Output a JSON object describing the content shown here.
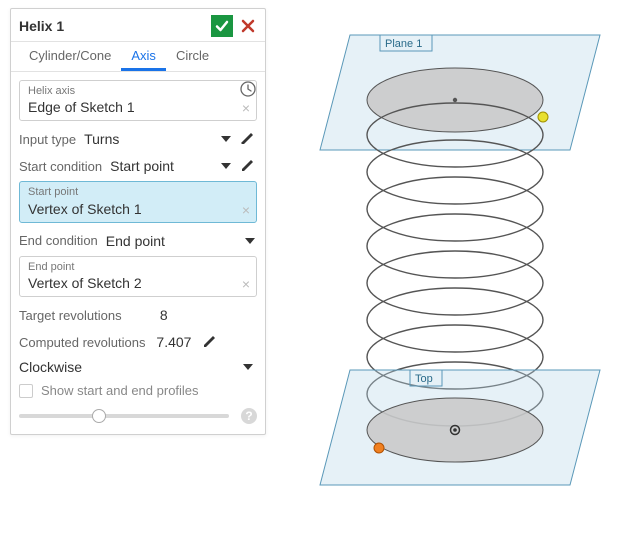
{
  "panel": {
    "title": "Helix 1",
    "tabs": [
      "Cylinder/Cone",
      "Axis",
      "Circle"
    ],
    "active_tab_index": 1,
    "helix_axis": {
      "label": "Helix axis",
      "value": "Edge of Sketch 1"
    },
    "input_type": {
      "label": "Input type",
      "value": "Turns"
    },
    "start_condition": {
      "label": "Start condition",
      "value": "Start point"
    },
    "start_point": {
      "label": "Start point",
      "value": "Vertex of Sketch 1",
      "active": true
    },
    "end_condition": {
      "label": "End condition",
      "value": "End point"
    },
    "end_point": {
      "label": "End point",
      "value": "Vertex of Sketch 2"
    },
    "target_revs": {
      "label": "Target revolutions",
      "value": "8"
    },
    "computed_revs": {
      "label": "Computed revolutions",
      "value": "7.407"
    },
    "direction": "Clockwise",
    "show_profiles": "Show start and end profiles"
  },
  "viewport": {
    "labels": {
      "top_plane": "Plane 1",
      "bottom_plane": "Top"
    }
  }
}
